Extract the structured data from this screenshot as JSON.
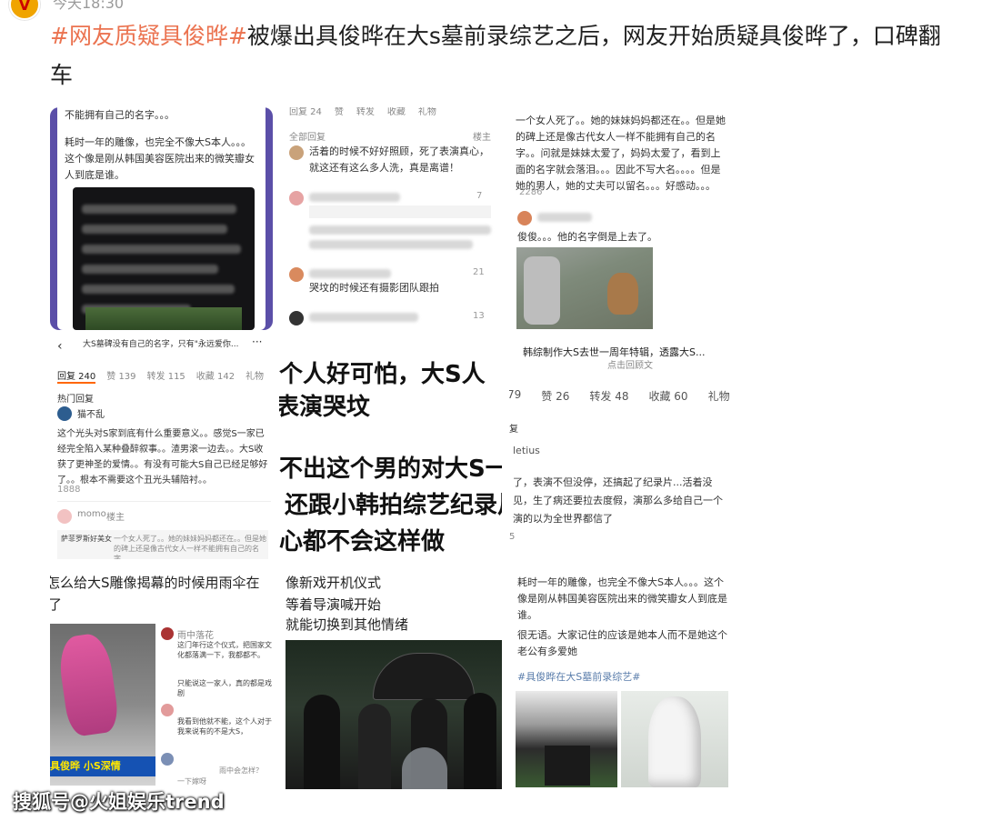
{
  "post": {
    "timestamp": "今天18:30",
    "hashtag": "#网友质疑具俊晔#",
    "text": "被爆出具俊晔在大s墓前录综艺之后，网友开始质疑具俊晔了，口碑翻车"
  },
  "grid": {
    "c1": {
      "top": "不能拥有自己的名字。。。",
      "p1": "耗时一年的雕像，也完全不像大S本人。。。",
      "p2": "这个像是刚从韩国美容医院出来的微笑瓣女人到底是谁。"
    },
    "c2": {
      "tabs": [
        "回复 24",
        "赞",
        "转发",
        "收藏",
        "礼物"
      ],
      "all": "全部回复",
      "owner": "楼主",
      "post": "活着的时候不好好照顾，死了表演真心，就这还有这么多人洗，真是离谱！",
      "cmt1_likes": "7",
      "cmt2_likes": "21",
      "cmt2": "哭坟的时候还有摄影团队跟拍",
      "cmt3_likes": "13"
    },
    "c3": {
      "text": "一个女人死了。。她的妹妹妈妈都还在。。但是她的碑上还是像古代女人一样不能拥有自己的名字。。问就是妹妹太爱了，妈妈太爱了，看到上面的名字就会落泪。。。因此不写大名。。。。但是她的男人，她的丈夫可以留名。。。好感动。。。",
      "likes": "2286",
      "reply": "俊俊。。。他的名字倒是上去了。"
    },
    "c4": {
      "title": "大S墓碑没有自己的名字，只有\"永远爱你...",
      "tabs": [
        "回复 240",
        "赞 139",
        "转发 115",
        "收藏 142",
        "礼物"
      ],
      "hot": "热门回复",
      "user": "猫不乱",
      "comment": "这个光头对S家到底有什么重要意义。。感觉S一家已经完全陷入某种叠醉叙事。。渣男滚一边去。。大S收获了更神圣的爱情。。有没有可能大S自己已经足够好了。。根本不需要这个丑光头辅陪衬。。",
      "likes": "1888",
      "user2": "momo",
      "owner": "楼主",
      "reply": "一个女人死了。。她的妹妹妈妈都还在。。但是她的碑上还是像古代女人一样不能拥有自己的名字。",
      "user3": "萨菲罗斯好美女"
    },
    "c5": {
      "line1": "这个人好可怕，大S人",
      "line2": "表演哭坟",
      "line3": "看不出这个男的对大S一丁",
      "line4": "，还跟小韩拍综艺纪录片",
      "line5": "良心都不会这样做"
    },
    "c6": {
      "title": "韩综制作大S去世一周年特辑，透露大S...",
      "sub": "点击回顾文",
      "tabs": [
        "79",
        "赞 26",
        "转发 48",
        "收藏 60",
        "礼物"
      ],
      "reply_label": "复",
      "user": "letius",
      "comment": "了，表演不但没停，还搞起了纪录片...活着没见，生了病还要拉去度假，演那么多给自己一个演的以为全世界都信了",
      "count": "5"
    },
    "c7": {
      "line1": "怎么给大S雕像揭幕的时候用雨伞在",
      "line2": "了",
      "news": "具俊晔 小S深情",
      "caption1": "这门年行这个仪式，把国家文化都落满一下，我都都不。",
      "caption2": "只能说这一家人，真的都是戏剧",
      "caption3": "我看到他就不能，这个人对于我来说有的不是大S，",
      "user": "雨中落花",
      "bottom": "雨中会怎样？",
      "bottom2": "一下嫁呀"
    },
    "c8": {
      "line1": "像新戏开机仪式",
      "line2": "等着导演喊开始",
      "line3": "就能切换到其他情绪"
    },
    "c9": {
      "p1": "耗时一年的雕像，也完全不像大S本人。。。这个像是刚从韩国美容医院出来的微笑瓣女人到底是谁。",
      "p2": "很无语。大家记住的应该是她本人而不是她这个老公有多爱她",
      "tag": "#具俊晔在大S墓前录综艺#"
    }
  },
  "watermark": "搜狐号@火姐娱乐trend"
}
